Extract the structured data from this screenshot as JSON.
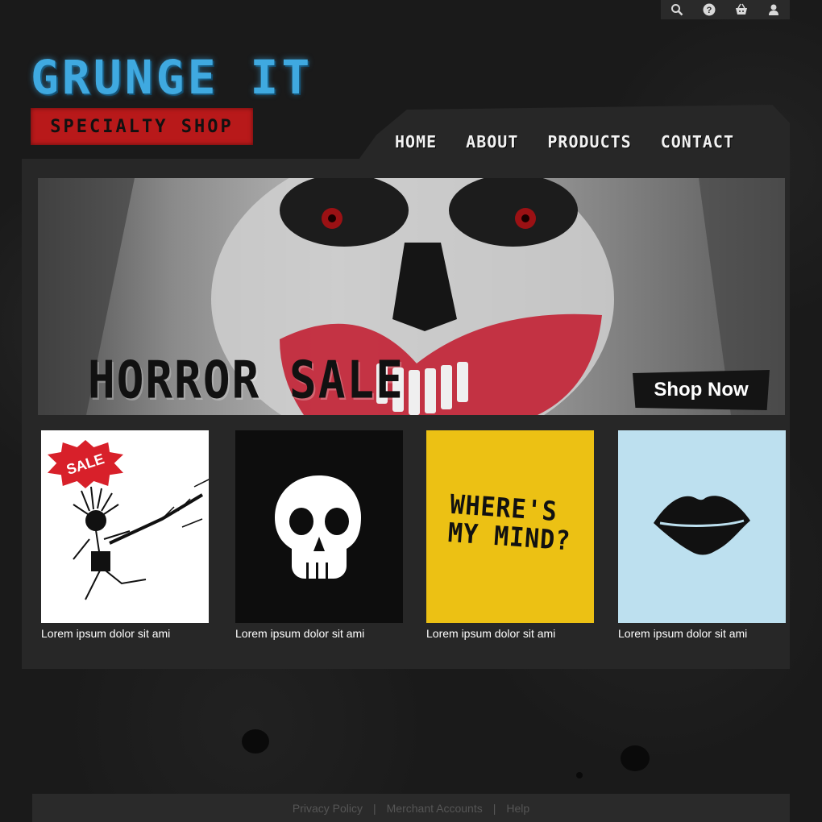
{
  "utility": {
    "icons": [
      "search-icon",
      "help-icon",
      "basket-icon",
      "user-icon"
    ]
  },
  "logo": {
    "title": "GRUNGE IT",
    "subtitle": "SPECIALTY SHOP"
  },
  "nav": {
    "items": [
      {
        "label": "HOME"
      },
      {
        "label": "ABOUT"
      },
      {
        "label": "PRODUCTS"
      },
      {
        "label": "CONTACT"
      }
    ]
  },
  "hero": {
    "title": "HORROR SALE",
    "cta_label": "Shop Now"
  },
  "products": [
    {
      "caption": "Lorem ipsum dolor sit ami",
      "badge": "SALE"
    },
    {
      "caption": "Lorem ipsum dolor sit ami"
    },
    {
      "caption": "Lorem ipsum dolor sit ami",
      "art_text": "WHERE'S MY MIND?"
    },
    {
      "caption": "Lorem ipsum dolor sit ami"
    }
  ],
  "footer": {
    "links": [
      {
        "label": "Privacy Policy"
      },
      {
        "label": "Merchant Accounts"
      },
      {
        "label": "Help"
      }
    ],
    "separator": "|"
  },
  "colors": {
    "accent_blue": "#3fa9e0",
    "brand_red": "#b8191a",
    "panel": "#272727",
    "background": "#1a1a1a",
    "tile_yellow": "#ecc114",
    "tile_blue": "#bde0ef"
  }
}
